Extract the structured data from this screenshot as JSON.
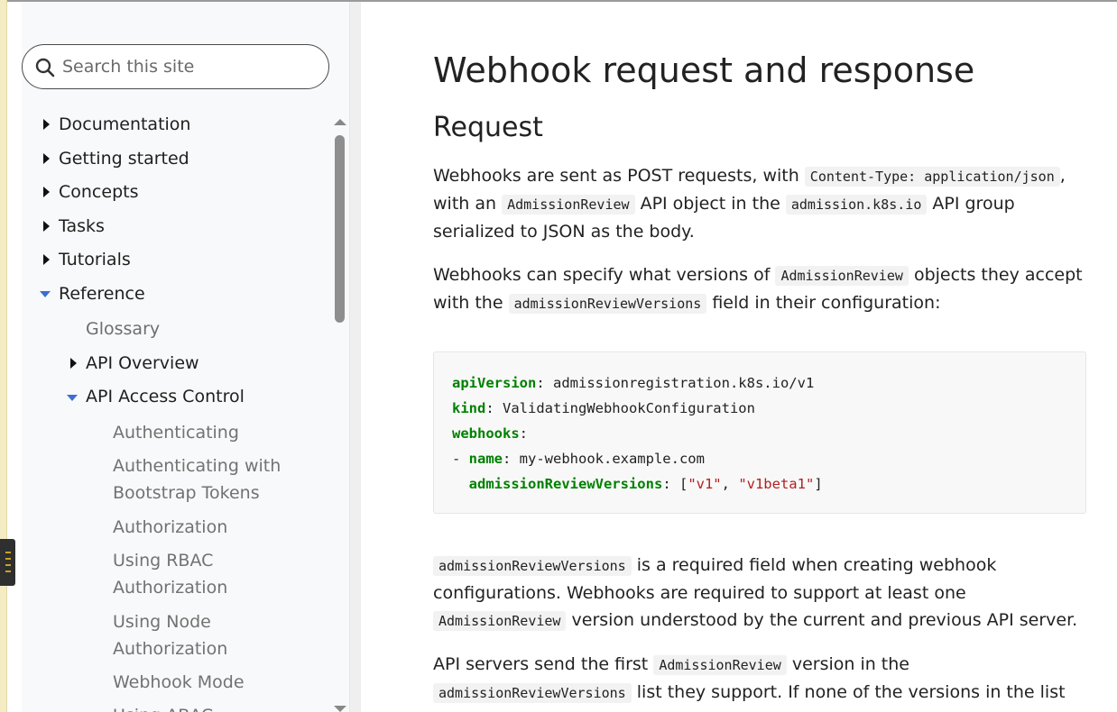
{
  "sidebar": {
    "search_placeholder": "Search this site",
    "items": [
      {
        "label": "Documentation"
      },
      {
        "label": "Getting started"
      },
      {
        "label": "Concepts"
      },
      {
        "label": "Tasks"
      },
      {
        "label": "Tutorials"
      },
      {
        "label": "Reference"
      },
      {
        "label": "Glossary"
      },
      {
        "label": "API Overview"
      },
      {
        "label": "API Access Control"
      },
      {
        "label": "Authenticating"
      },
      {
        "label": "Authenticating with",
        "label2": "Bootstrap Tokens"
      },
      {
        "label": "Authorization"
      },
      {
        "label": "Using RBAC",
        "label2": "Authorization"
      },
      {
        "label": "Using Node",
        "label2": "Authorization"
      },
      {
        "label": "Webhook Mode"
      },
      {
        "label": "Using ABAC"
      }
    ]
  },
  "main": {
    "title": "Webhook request and response",
    "section": "Request",
    "p1": {
      "t1": "Webhooks are sent as POST requests, with ",
      "c1": "Content-Type: application/json",
      "t2": ",",
      "t3": "with an ",
      "c2": "AdmissionReview",
      "t4": " API object in the ",
      "c3": "admission.k8s.io",
      "t5": " API group",
      "t6": "serialized to JSON as the body."
    },
    "p2": {
      "t1": "Webhooks can specify what versions of ",
      "c1": "AdmissionReview",
      "t2": " objects they accept",
      "t3": "with the ",
      "c2": "admissionReviewVersions",
      "t4": " field in their configuration:"
    },
    "code": {
      "l1k": "apiVersion",
      "l1v": ": admissionregistration.k8s.io/v1",
      "l2k": "kind",
      "l2v": ": ValidatingWebhookConfiguration",
      "l3k": "webhooks",
      "l3v": ":",
      "l4p": "- ",
      "l4k": "name",
      "l4v": ": my-webhook.example.com",
      "l5p": "  ",
      "l5k": "admissionReviewVersions",
      "l5a": ": [",
      "l5s1": "\"v1\"",
      "l5b": ", ",
      "l5s2": "\"v1beta1\"",
      "l5c": "]"
    },
    "p3": {
      "c1": "admissionReviewVersions",
      "t1": " is a required field when creating webhook",
      "t2": "configurations. Webhooks are required to support at least one",
      "c2": "AdmissionReview",
      "t3": " version understood by the current and previous API server."
    },
    "p4": {
      "t1": "API servers send the first ",
      "c1": "AdmissionReview",
      "t2": " version in the",
      "c2": "admissionReviewVersions",
      "t3": " list they support. If none of the versions in the list"
    }
  }
}
